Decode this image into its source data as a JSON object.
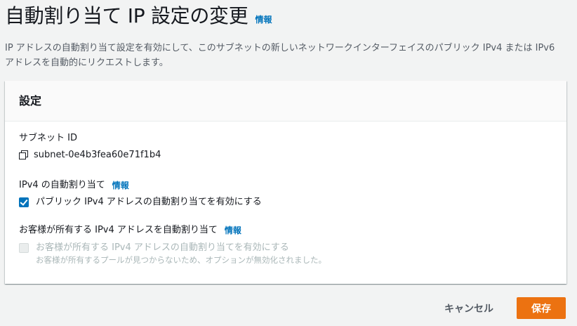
{
  "header": {
    "title": "自動割り当て IP 設定の変更",
    "info_label": "情報"
  },
  "description": "IP アドレスの自動割り当て設定を有効にして、このサブネットの新しいネットワークインターフェイスのパブリック IPv4 または IPv6 アドレスを自動的にリクエストします。",
  "panel": {
    "title": "設定",
    "subnet": {
      "label": "サブネット ID",
      "value": "subnet-0e4b3fea60e71f1b4"
    },
    "ipv4_auto": {
      "label": "IPv4 の自動割り当て",
      "info_label": "情報",
      "checkbox_label": "パブリック IPv4 アドレスの自動割り当てを有効にする",
      "checked": true
    },
    "customer_ipv4": {
      "label": "お客様が所有する IPv4 アドレスを自動割り当て",
      "info_label": "情報",
      "checkbox_label": "お客様が所有する IPv4 アドレスの自動割り当てを有効にする",
      "checkbox_sublabel": "お客様が所有するプールが見つからないため、オプションが無効化されました。",
      "checked": false,
      "disabled": true
    }
  },
  "actions": {
    "cancel_label": "キャンセル",
    "save_label": "保存"
  },
  "colors": {
    "link": "#0073bb",
    "primary_button": "#ec7211",
    "checkbox_checked": "#0073bb",
    "disabled_text": "#aab7b8",
    "page_background": "#f2f3f3"
  }
}
